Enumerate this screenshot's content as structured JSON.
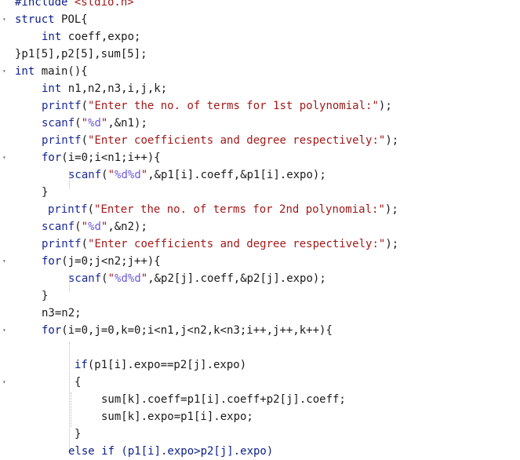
{
  "editor": {
    "lines": [
      {
        "indent": 0,
        "tokens": [
          {
            "t": "#include ",
            "c": "kw"
          },
          {
            "t": "<stdio.h>",
            "c": "str"
          }
        ]
      },
      {
        "indent": 0,
        "fold": true,
        "tokens": [
          {
            "t": "struct ",
            "c": "kw"
          },
          {
            "t": "POL{",
            "c": ""
          }
        ]
      },
      {
        "indent": 1,
        "tokens": [
          {
            "t": "int ",
            "c": "kw"
          },
          {
            "t": "coeff,expo;",
            "c": ""
          }
        ]
      },
      {
        "indent": 0,
        "tokens": [
          {
            "t": "}p1[5],p2[5],sum[5];",
            "c": ""
          }
        ]
      },
      {
        "indent": 0,
        "fold": true,
        "tokens": [
          {
            "t": "int ",
            "c": "kw"
          },
          {
            "t": "main(){",
            "c": ""
          }
        ]
      },
      {
        "indent": 1,
        "tokens": [
          {
            "t": "int ",
            "c": "kw"
          },
          {
            "t": "n1,n2,n3,i,j,k;",
            "c": ""
          }
        ]
      },
      {
        "indent": 1,
        "tokens": [
          {
            "t": "printf",
            "c": "fn"
          },
          {
            "t": "(",
            "c": ""
          },
          {
            "t": "\"Enter the no. of terms for 1st polynomial:\"",
            "c": "str"
          },
          {
            "t": ");",
            "c": ""
          }
        ]
      },
      {
        "indent": 1,
        "tokens": [
          {
            "t": "scanf",
            "c": "fn"
          },
          {
            "t": "(",
            "c": ""
          },
          {
            "t": "\"",
            "c": "str"
          },
          {
            "t": "%d",
            "c": "fmt"
          },
          {
            "t": "\"",
            "c": "str"
          },
          {
            "t": ",&n1);",
            "c": ""
          }
        ]
      },
      {
        "indent": 1,
        "tokens": [
          {
            "t": "printf",
            "c": "fn"
          },
          {
            "t": "(",
            "c": ""
          },
          {
            "t": "\"Enter coefficients and degree respectively:\"",
            "c": "str"
          },
          {
            "t": ");",
            "c": ""
          }
        ]
      },
      {
        "indent": 1,
        "fold": true,
        "tokens": [
          {
            "t": "for",
            "c": "kw"
          },
          {
            "t": "(i=0;i<n1;i++){",
            "c": ""
          }
        ]
      },
      {
        "indent": 2,
        "tokens": [
          {
            "t": "scanf",
            "c": "fn"
          },
          {
            "t": "(",
            "c": ""
          },
          {
            "t": "\"",
            "c": "str"
          },
          {
            "t": "%d%d",
            "c": "fmt"
          },
          {
            "t": "\"",
            "c": "str"
          },
          {
            "t": ",&p1[i].coeff,&p1[i].expo);",
            "c": ""
          }
        ]
      },
      {
        "indent": 1,
        "tokens": [
          {
            "t": "}",
            "c": ""
          }
        ]
      },
      {
        "indent": 1,
        "extra": 1,
        "tokens": [
          {
            "t": "printf",
            "c": "fn"
          },
          {
            "t": "(",
            "c": ""
          },
          {
            "t": "\"Enter the no. of terms for 2nd polynomial:\"",
            "c": "str"
          },
          {
            "t": ");",
            "c": ""
          }
        ]
      },
      {
        "indent": 1,
        "tokens": [
          {
            "t": "scanf",
            "c": "fn"
          },
          {
            "t": "(",
            "c": ""
          },
          {
            "t": "\"",
            "c": "str"
          },
          {
            "t": "%d",
            "c": "fmt"
          },
          {
            "t": "\"",
            "c": "str"
          },
          {
            "t": ",&n2);",
            "c": ""
          }
        ]
      },
      {
        "indent": 1,
        "tokens": [
          {
            "t": "printf",
            "c": "fn"
          },
          {
            "t": "(",
            "c": ""
          },
          {
            "t": "\"Enter coefficients and degree respectively:\"",
            "c": "str"
          },
          {
            "t": ");",
            "c": ""
          }
        ]
      },
      {
        "indent": 1,
        "fold": true,
        "tokens": [
          {
            "t": "for",
            "c": "kw"
          },
          {
            "t": "(j=0;j<n2;j++){",
            "c": ""
          }
        ]
      },
      {
        "indent": 2,
        "tokens": [
          {
            "t": "scanf",
            "c": "fn"
          },
          {
            "t": "(",
            "c": ""
          },
          {
            "t": "\"",
            "c": "str"
          },
          {
            "t": "%d%d",
            "c": "fmt"
          },
          {
            "t": "\"",
            "c": "str"
          },
          {
            "t": ",&p2[j].coeff,&p2[j].expo);",
            "c": ""
          }
        ]
      },
      {
        "indent": 1,
        "tokens": [
          {
            "t": "}",
            "c": ""
          }
        ]
      },
      {
        "indent": 1,
        "tokens": [
          {
            "t": "n3=n2;",
            "c": ""
          }
        ]
      },
      {
        "indent": 1,
        "fold": true,
        "tokens": [
          {
            "t": "for",
            "c": "kw"
          },
          {
            "t": "(i=0,j=0,k=0;i<n1,j<n2,k<n3;i++,j++,k++){",
            "c": ""
          }
        ]
      },
      {
        "indent": 0,
        "tokens": []
      },
      {
        "indent": 2,
        "extra": 1,
        "tokens": [
          {
            "t": "if",
            "c": "kw"
          },
          {
            "t": "(p1[i].expo==p2[j].expo)",
            "c": ""
          }
        ]
      },
      {
        "indent": 2,
        "extra": 1,
        "fold": true,
        "tokens": [
          {
            "t": "{",
            "c": ""
          }
        ]
      },
      {
        "indent": 3,
        "extra": 1,
        "tokens": [
          {
            "t": "sum[k].coeff=p1[i].coeff+p2[j].coeff;",
            "c": ""
          }
        ]
      },
      {
        "indent": 3,
        "extra": 1,
        "tokens": [
          {
            "t": "sum[k].expo=p1[i].expo;",
            "c": ""
          }
        ]
      },
      {
        "indent": 2,
        "extra": 1,
        "tokens": [
          {
            "t": "}",
            "c": ""
          }
        ]
      },
      {
        "indent": 2,
        "tokens": [
          {
            "t": "else if (p1[i].expo>p2[j].expo)",
            "c": "kw"
          }
        ]
      }
    ],
    "colors": {
      "keyword": "#0b1e8a",
      "string": "#a11a1a",
      "format": "#6b5bd9"
    }
  }
}
